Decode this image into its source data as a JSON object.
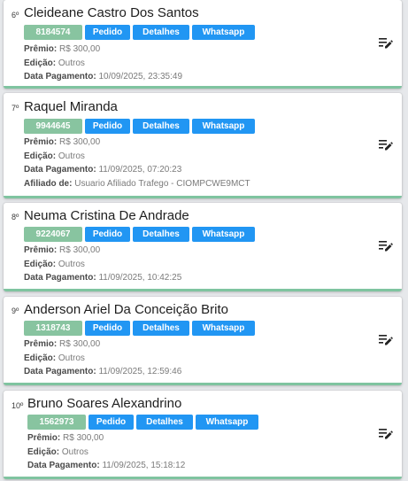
{
  "labels": {
    "premio": "Prêmio:",
    "edicao": "Edição:",
    "data_pagamento": "Data Pagamento:",
    "afiliado": "Afiliado de:"
  },
  "buttons": {
    "pedido": "Pedido",
    "detalhes": "Detalhes",
    "whatsapp": "Whatsapp"
  },
  "colors": {
    "badge": "#88c4a0",
    "button": "#2196f3",
    "card_border": "#7fc4a0"
  },
  "entries": [
    {
      "rank": "6º",
      "name": "Cleideane Castro Dos Santos",
      "code": "8184574",
      "premio": "R$ 300,00",
      "edicao": "Outros",
      "data_pagamento": "10/09/2025, 23:35:49"
    },
    {
      "rank": "7º",
      "name": "Raquel Miranda",
      "code": "9944645",
      "premio": "R$ 300,00",
      "edicao": "Outros",
      "data_pagamento": "11/09/2025, 07:20:23",
      "afiliado": "Usuario Afiliado Trafego - CIOMPCWE9MCT"
    },
    {
      "rank": "8º",
      "name": "Neuma Cristina De Andrade",
      "code": "9224067",
      "premio": "R$ 300,00",
      "edicao": "Outros",
      "data_pagamento": "11/09/2025, 10:42:25"
    },
    {
      "rank": "9º",
      "name": "Anderson Ariel Da Conceição Brito",
      "code": "1318743",
      "premio": "R$ 300,00",
      "edicao": "Outros",
      "data_pagamento": "11/09/2025, 12:59:46"
    },
    {
      "rank": "10º",
      "name": "Bruno Soares Alexandrino",
      "code": "1562973",
      "premio": "R$ 300,00",
      "edicao": "Outros",
      "data_pagamento": "11/09/2025, 15:18:12"
    }
  ]
}
